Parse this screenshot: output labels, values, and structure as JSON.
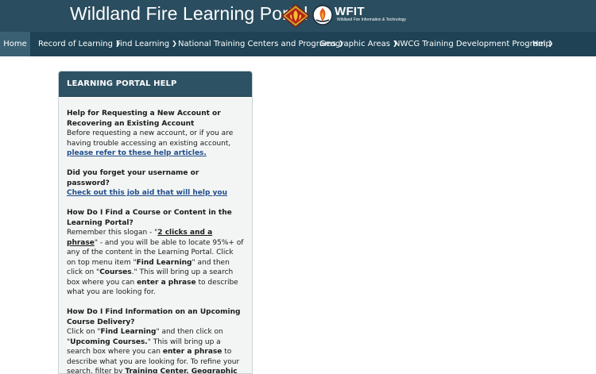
{
  "banner": {
    "title": "Wildland Fire Learning Portal",
    "wfit_logo_text": "WFIT",
    "wfit_logo_sub": "Wildland Fire Information & Technology"
  },
  "nav": {
    "items": [
      {
        "label": "Home",
        "active": true,
        "dropdown": false
      },
      {
        "label": "Record of Learning",
        "dropdown": true
      },
      {
        "label": "Find Learning",
        "dropdown": true
      },
      {
        "label": "National Training Centers and Programs",
        "dropdown": true
      },
      {
        "label": "Geographic Areas",
        "dropdown": true
      },
      {
        "label": "NWCG Training Development Program",
        "dropdown": true
      },
      {
        "label": "Help",
        "dropdown": false
      }
    ]
  },
  "help_panel": {
    "title": "LEARNING PORTAL HELP",
    "account": {
      "question": "Help for Requesting a New Account or Recovering an Existing Account",
      "text": "Before requesting a new account, or if you are having trouble accessing an existing account,",
      "link": "please refer to these help articles."
    },
    "forgot": {
      "question": "Did you forget your username or password?",
      "link": "Check out this job aid that will help you"
    },
    "find_course": {
      "question": "How Do I Find a Course or Content in the Learning Portal?",
      "t1": "Remember this slogan - \"",
      "slogan": "2 clicks and a phrase",
      "t2": "\" - and you will be able to locate 95%+ of any of the content in the Learning Portal. Click on top menu item \"",
      "b1": "Find Learning",
      "t3": "\" and then click on \"",
      "b2": "Courses",
      "t4": ".\" This will bring up a search box where you can",
      "b3": "enter a phrase",
      "t5": "to describe what you are looking for."
    },
    "upcoming": {
      "question": "How Do I Find Information on an Upcoming Course Delivery?",
      "t1": "Click on \"",
      "b1": "Find Learning",
      "t2": "\" and then click on \"",
      "b2": "Upcoming Courses.",
      "t3": "\" This will bring up a search box where you can",
      "b3": "enter a phrase",
      "t4": "to describe what you are looking for. To refine your search, filter by",
      "b4": "Training Center, Geographic Area, or Zone."
    }
  },
  "colors": {
    "banner": "#2a4d5f",
    "nav": "#1f4355",
    "nav_active": "#3a6173",
    "panel_header": "#2d5264",
    "panel_body": "#f3f5f5",
    "link": "#1f4d8a"
  },
  "icons": [
    "fire-agency-logo-icon",
    "wfit-logo-icon",
    "chevron-down-icon"
  ]
}
